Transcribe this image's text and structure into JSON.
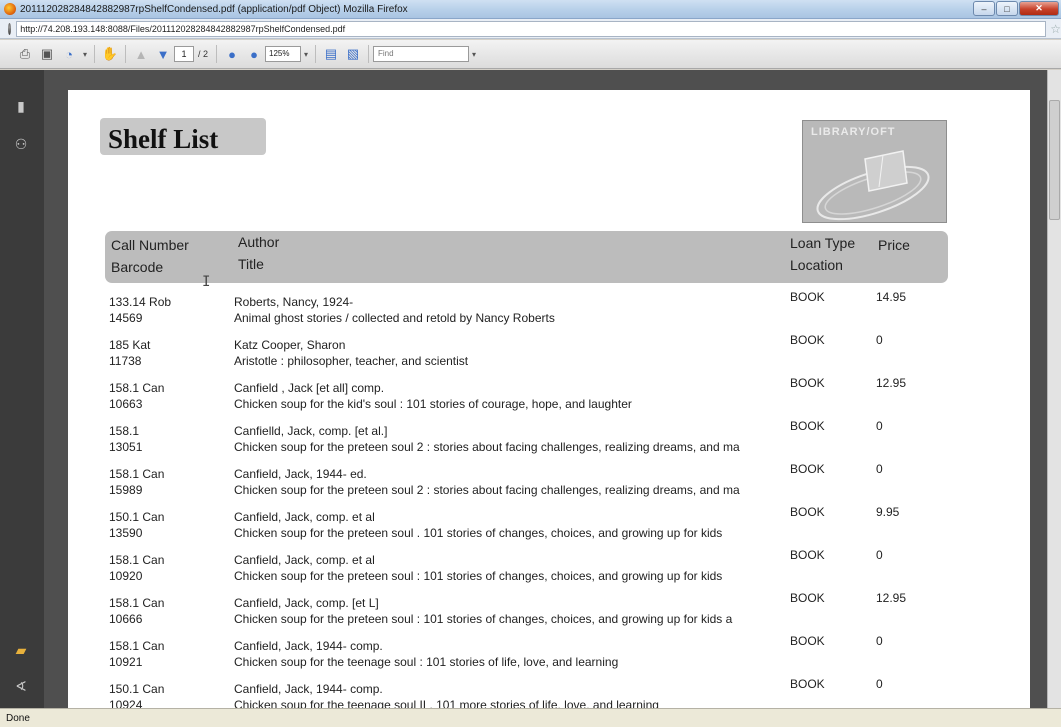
{
  "window": {
    "title": "201112028284842882987rpShelfCondensed.pdf (application/pdf Object)  Mozilla Firefox",
    "url": "http://74.208.193.148:8088/Files/201112028284842882987rpShelfCondensed.pdf"
  },
  "toolbar": {
    "page_current": "1",
    "page_total": "/ 2",
    "zoom": "125%",
    "find_placeholder": "Find"
  },
  "report": {
    "title": "Shelf List",
    "logo_text": "LIBRARY/OFT",
    "headers": {
      "call_number": "Call Number",
      "barcode": "Barcode",
      "author": "Author",
      "title": "Title",
      "loan_type": "Loan Type",
      "location": "Location",
      "price": "Price"
    },
    "rows": [
      {
        "call": "133.14 Rob",
        "barcode": "14569",
        "author": "Roberts, Nancy, 1924-",
        "title": "Animal ghost stories / collected and retold by Nancy Roberts",
        "loan": "BOOK",
        "price": "14.95"
      },
      {
        "call": "185 Kat",
        "barcode": "11738",
        "author": "Katz Cooper, Sharon",
        "title": "Aristotle : philosopher, teacher, and scientist",
        "loan": "BOOK",
        "price": "0"
      },
      {
        "call": "158.1 Can",
        "barcode": "10663",
        "author": "Canfield , Jack [et all]  comp.",
        "title": "Chicken soup for the kid's soul : 101 stories of  courage, hope, and laughter",
        "loan": "BOOK",
        "price": "12.95"
      },
      {
        "call": "158.1",
        "barcode": "13051",
        "author": "Canfielld, Jack, comp. [et al.]",
        "title": "Chicken soup for the preteen soul 2 : stories about facing challenges, realizing dreams, and ma",
        "loan": "BOOK",
        "price": "0"
      },
      {
        "call": "158.1 Can",
        "barcode": "15989",
        "author": "Canfield, Jack, 1944- ed.",
        "title": "Chicken soup for the preteen soul 2 : stories about facing challenges, realizing dreams, and ma",
        "loan": "BOOK",
        "price": "0"
      },
      {
        "call": "150.1 Can",
        "barcode": "13590",
        "author": "Canfield, Jack, comp. et al",
        "title": "Chicken soup for the preteen soul . 101 stories of changes, choices, and growing up for kids",
        "loan": "BOOK",
        "price": "9.95"
      },
      {
        "call": "158.1 Can",
        "barcode": "10920",
        "author": "Canfield, Jack, comp. et al",
        "title": "Chicken soup for the preteen soul : 101 stories of changes, choices, and growing up for kids",
        "loan": "BOOK",
        "price": "0"
      },
      {
        "call": "158.1 Can",
        "barcode": "10666",
        "author": "Canfield, Jack, comp.  [et L]",
        "title": "Chicken soup for the preteen soul : 101 stories of changes, choices, and growing up for kids a",
        "loan": "BOOK",
        "price": "12.95"
      },
      {
        "call": "158.1 Can",
        "barcode": "10921",
        "author": "Canfield, Jack, 1944- comp.",
        "title": "Chicken soup for the teenage soul : 101 stories of life, love, and learning",
        "loan": "BOOK",
        "price": "0"
      },
      {
        "call": "150.1 Can",
        "barcode": "10924",
        "author": "Canfield, Jack, 1944-  comp.",
        "title": "Chicken soup for the teenage soul II . 101 more stories of life, love, and learning",
        "loan": "BOOK",
        "price": "0"
      }
    ]
  },
  "status": {
    "text": "Done"
  }
}
